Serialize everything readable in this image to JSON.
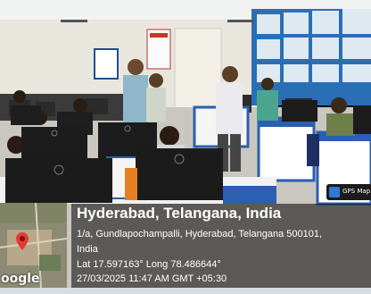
{
  "map": {
    "brand_text": "oogle",
    "pin_icon": "map-pin-icon"
  },
  "badge": {
    "text": "GPS Map",
    "icon": "gps-camera-icon"
  },
  "location": {
    "title": "Hyderabad, Telangana, India",
    "address_line1": "1/a, Gundlapochampalli, Hyderabad, Telangana 500101,",
    "address_line2": "India",
    "coords": "Lat 17.597163° Long 78.486644°",
    "datetime": "27/03/2025 11:47 AM GMT +05:30"
  }
}
